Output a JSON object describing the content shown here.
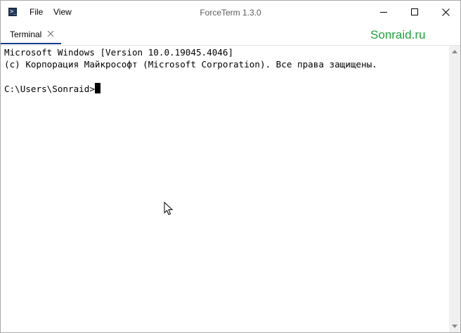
{
  "window": {
    "title": "ForceTerm 1.3.0",
    "app_icon": "terminal-app-icon",
    "app_icon_glyph": ">_"
  },
  "menu": {
    "items": [
      {
        "label": "File"
      },
      {
        "label": "View"
      }
    ]
  },
  "window_controls": {
    "minimize_icon": "minimize-icon",
    "maximize_icon": "maximize-icon",
    "close_icon": "close-icon"
  },
  "tabs": [
    {
      "label": "Terminal",
      "active": true,
      "close_icon": "close-icon"
    }
  ],
  "watermark": "Sonraid.ru",
  "terminal": {
    "lines": [
      "Microsoft Windows [Version 10.0.19045.4046]",
      "(c) Корпорация Майкрософт (Microsoft Corporation). Все права защищены.",
      ""
    ],
    "prompt": "C:\\Users\\Sonraid>",
    "cursor_style": "block"
  },
  "colors": {
    "accent": "#0a3d8f",
    "watermark": "#1fa13b",
    "title_text": "#5a5a5a",
    "terminal_background": "#ffffff",
    "terminal_text": "#000000"
  }
}
